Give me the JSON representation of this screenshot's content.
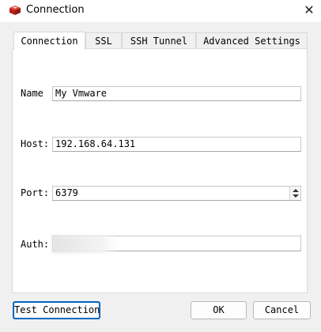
{
  "window": {
    "title": "Connection"
  },
  "tabs": [
    {
      "label": "Connection",
      "active": true
    },
    {
      "label": "SSL",
      "active": false
    },
    {
      "label": "SSH Tunnel",
      "active": false
    },
    {
      "label": "Advanced Settings",
      "active": false
    }
  ],
  "form": {
    "name": {
      "label": "Name",
      "value": "My Vmware"
    },
    "host": {
      "label": "Host:",
      "value": "192.168.64.131"
    },
    "port": {
      "label": "Port:",
      "value": "6379"
    },
    "auth": {
      "label": "Auth:",
      "value": ""
    }
  },
  "buttons": {
    "test_connection": "Test Connection",
    "ok": "OK",
    "cancel": "Cancel"
  },
  "icons": {
    "app": "redis-logo-icon",
    "close": "close-icon",
    "spin_up": "spin-up-icon",
    "spin_down": "spin-down-icon"
  },
  "colors": {
    "accent": "#0067c0",
    "app_icon": "#c8271b"
  }
}
